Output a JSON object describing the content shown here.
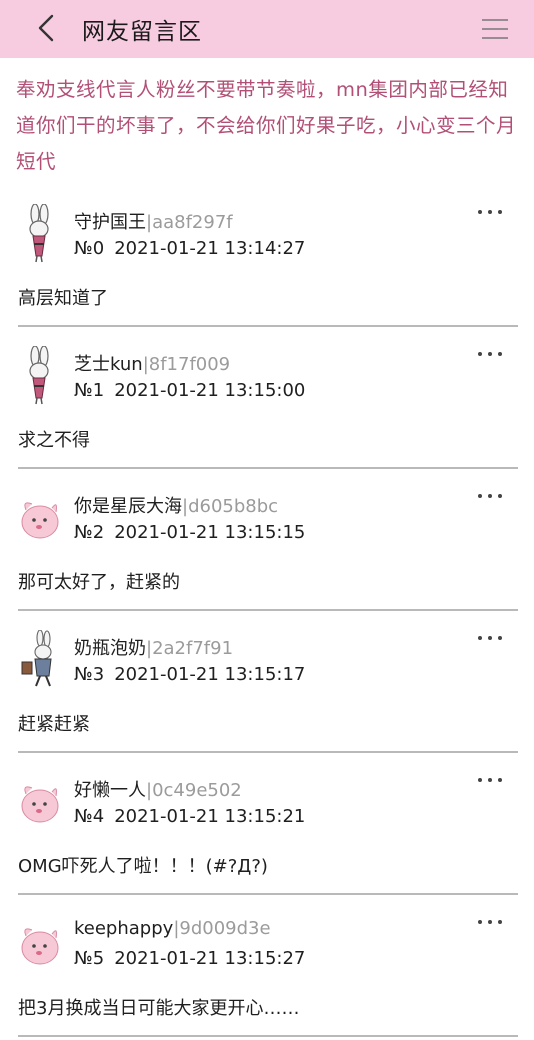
{
  "header": {
    "title": "网友留言区",
    "back_icon": "chevron-left-icon",
    "menu_icon": "hamburger-menu-icon",
    "background": "#f8cce0"
  },
  "notice": {
    "text": "奉劝支线代言人粉丝不要带节奏啦，mn集团内部已经知道你们干的坏事了，不会给你们好果子吃，小心变三个月短代",
    "color": "#b24f76"
  },
  "comments": [
    {
      "name": "守护国王",
      "uid": "|aa8f297f",
      "no": "№0",
      "time": "2021-01-21 13:14:27",
      "text": "高层知道了",
      "avatar": "rabbit-doll-avatar"
    },
    {
      "name": "芝士kun",
      "uid": "|8f17f009",
      "no": "№1",
      "time": "2021-01-21 13:15:00",
      "text": "求之不得",
      "avatar": "rabbit-doll-avatar"
    },
    {
      "name": "你是星辰大海",
      "uid": "|d605b8bc",
      "no": "№2",
      "time": "2021-01-21 13:15:15",
      "text": "那可太好了，赶紧的",
      "avatar": "pink-blob-avatar"
    },
    {
      "name": "奶瓶泡奶",
      "uid": "|2a2f7f91",
      "no": "№3",
      "time": "2021-01-21 13:15:17",
      "text": "赶紧赶紧",
      "avatar": "rabbit-suit-avatar"
    },
    {
      "name": "好懒一人",
      "uid": "|0c49e502",
      "no": "№4",
      "time": "2021-01-21 13:15:21",
      "text": "OMG吓死人了啦！！！(#?Д?)",
      "avatar": "pink-blob-avatar"
    },
    {
      "name": "keephappy",
      "uid": "|9d009d3e",
      "no": "№5",
      "time": "2021-01-21 13:15:27",
      "text": "把3月换成当日可能大家更开心……",
      "avatar": "pink-blob-avatar"
    }
  ]
}
